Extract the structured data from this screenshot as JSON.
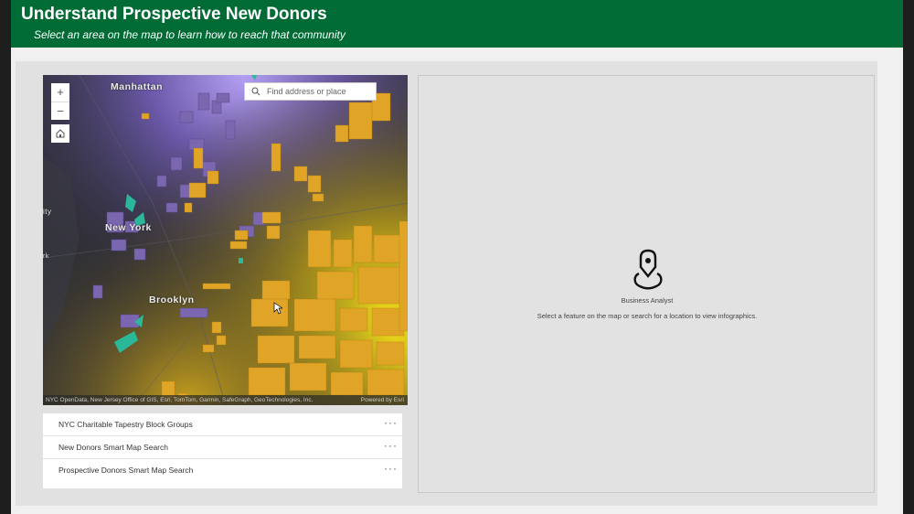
{
  "header": {
    "title": "Understand Prospective New Donors",
    "subtitle": "Select an area on the map to learn how to reach that community"
  },
  "map": {
    "zoom_in": "+",
    "zoom_out": "−",
    "search_placeholder": "Find address or place",
    "labels": {
      "manhattan": "Manhattan",
      "new_york": "New York",
      "brooklyn": "Brooklyn",
      "city_fragment": "ity",
      "park_fragment": "rk"
    },
    "attribution": "NYC OpenData, New Jersey Office of GIS, Esri, TomTom, Garmin, SafeGraph, GeoTechnologies, Inc.",
    "powered_by": "Powered by Esri"
  },
  "layers": [
    {
      "label": "NYC Charitable Tapestry Block Groups",
      "menu": "···"
    },
    {
      "label": "New Donors Smart Map Search",
      "menu": "···"
    },
    {
      "label": "Prospective Donors Smart Map Search",
      "menu": "···"
    }
  ],
  "infographic": {
    "title": "Business Analyst",
    "message": "Select a feature on the map or search for a location to view infographics."
  },
  "colors": {
    "header": "#006b35",
    "block_gold": "#e0a526",
    "block_purple": "#7b66b0",
    "block_teal": "#2ab79a"
  }
}
